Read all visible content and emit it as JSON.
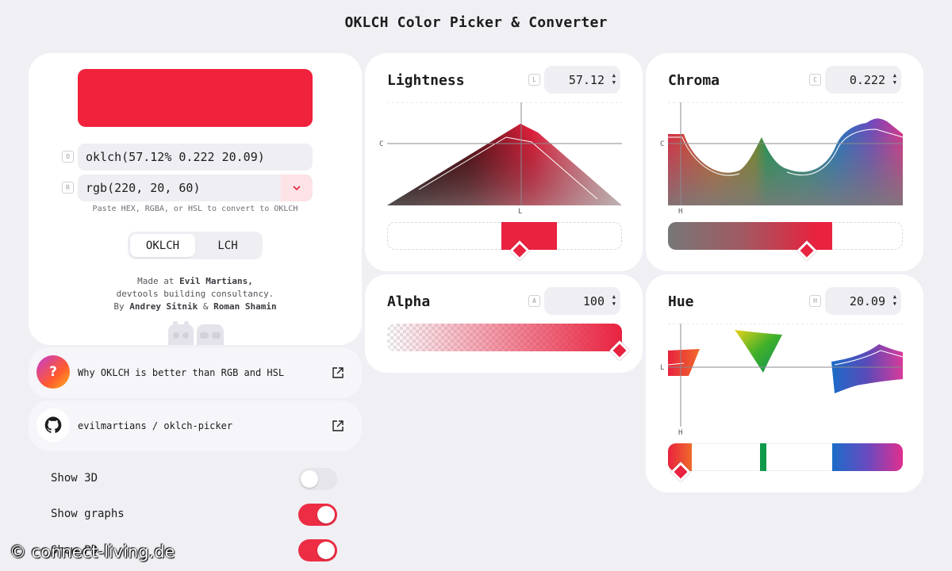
{
  "page": {
    "title": "OKLCH Color Picker & Converter"
  },
  "accent_color": "#dc143c",
  "left_panel": {
    "formats": [
      {
        "tag": "O",
        "value": "oklch(57.12% 0.222 20.09)"
      },
      {
        "tag": "R",
        "value": "rgb(220, 20, 60)",
        "dropdown_icon": "chevron-down-icon"
      }
    ],
    "hint": "Paste HEX, RGBA, or HSL to convert to OKLCH",
    "modes": [
      "OKLCH",
      "LCH"
    ],
    "active_mode": "OKLCH",
    "credits": {
      "line1_prefix": "Made at",
      "line1_name": "Evil Martians,",
      "line2": "devtools building consultancy.",
      "line3_prefix": "By",
      "author1": "Andrey Sitnik",
      "amp": "&",
      "author2": "Roman Shamin"
    }
  },
  "links": [
    {
      "text": "Why OKLCH is better than RGB and HSL",
      "icon": "question-icon",
      "icon_glyph": "?"
    },
    {
      "text": "evilmartians / oklch-picker",
      "icon": "github-icon"
    }
  ],
  "options": [
    {
      "label": "Show 3D",
      "on": false
    },
    {
      "label": "Show graphs",
      "on": true
    },
    {
      "label": "Show P3",
      "on": true
    }
  ],
  "channels": {
    "lightness": {
      "title": "Lightness",
      "tag": "L",
      "value": "57.12",
      "chart_axis_label": "C",
      "slider_axis_label": "L",
      "slider_position": 0.5712
    },
    "chroma": {
      "title": "Chroma",
      "tag": "C",
      "value": "0.222",
      "chart_axis_label": "C",
      "slider_axis_label": "H",
      "slider_position": 0.59
    },
    "alpha": {
      "title": "Alpha",
      "tag": "A",
      "value": "100",
      "slider_position": 1.0
    },
    "hue": {
      "title": "Hue",
      "tag": "H",
      "value": "20.09",
      "chart_axis_label": "L",
      "slider_axis_label": "H",
      "slider_position": 0.0558
    }
  },
  "watermark": "© connect-living.de"
}
